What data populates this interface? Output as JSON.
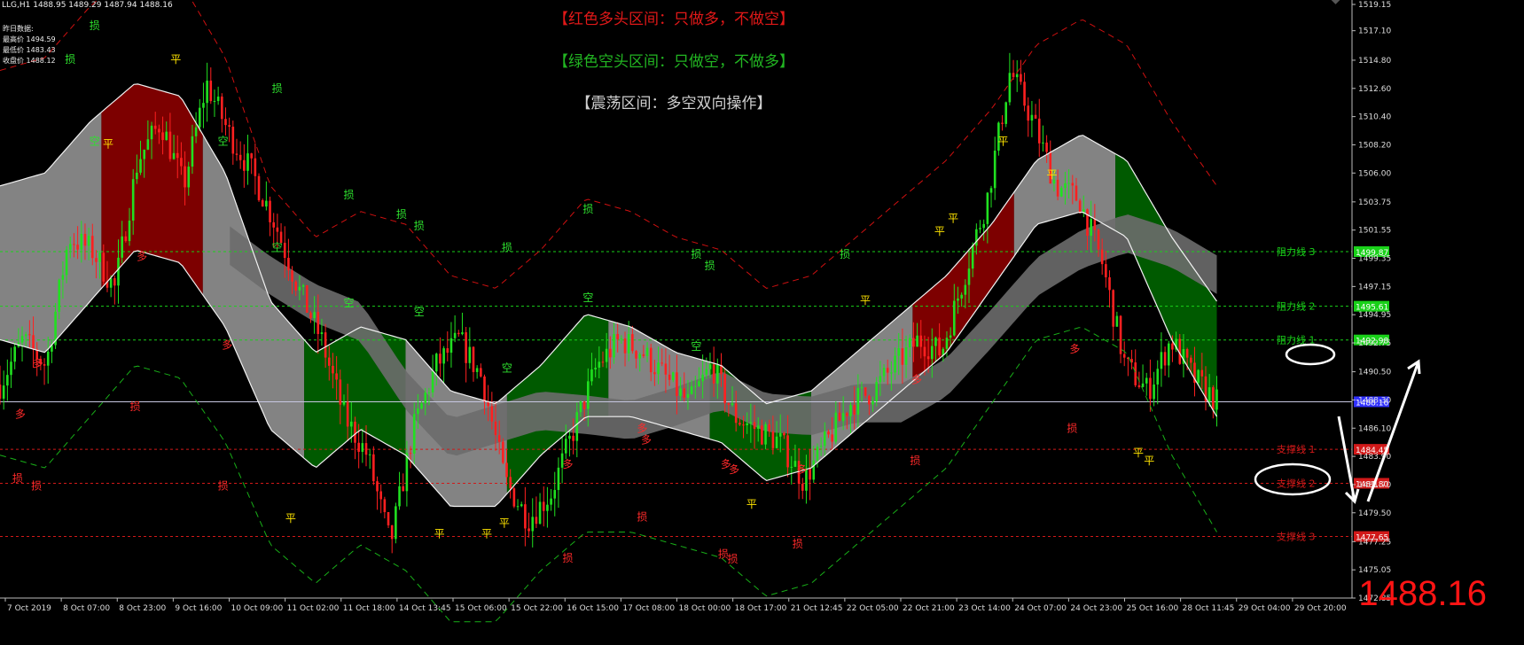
{
  "header": {
    "symbol_line": "LLG,H1  1488.95 1489.29 1487.94 1488.16",
    "prev_day_title": "昨日数据:",
    "prev_high": "最高价 1494.59",
    "prev_low": "最低价 1483.43",
    "prev_close": "收盘价 1488.12"
  },
  "banners": {
    "red": "【红色多头区间：只做多，不做空】",
    "green": "【绿色空头区间：只做空，不做多】",
    "gray": "【震荡区间：多空双向操作】"
  },
  "current_price": "1488.16",
  "colors": {
    "bull_zone": "#8b0000",
    "bear_zone": "#006400",
    "range_zone": "#9a9a9a",
    "candle_up": "#20e020",
    "candle_down": "#ff2020",
    "resistance": "#19d119",
    "support": "#d11919",
    "current_line": "#3030ff",
    "marker_yellow": "#ffe400"
  },
  "chart_data": {
    "type": "line",
    "title": "LLG,H1",
    "ylim": [
      1472.85,
      1519.15
    ],
    "y_ticks": [
      "1519.15",
      "1517.10",
      "1514.80",
      "1512.60",
      "1510.40",
      "1508.20",
      "1506.00",
      "1503.75",
      "1501.55",
      "1499.35",
      "1497.15",
      "1494.95",
      "1492.75",
      "1490.50",
      "1488.30",
      "1486.10",
      "1483.90",
      "1481.70",
      "1479.50",
      "1477.25",
      "1475.05",
      "1472.85"
    ],
    "x_labels": [
      "7 Oct 2019",
      "8 Oct 07:00",
      "8 Oct 23:00",
      "9 Oct 16:00",
      "10 Oct 09:00",
      "11 Oct 02:00",
      "11 Oct 18:00",
      "14 Oct 13:45",
      "15 Oct 06:00",
      "15 Oct 22:00",
      "16 Oct 15:00",
      "17 Oct 08:00",
      "18 Oct 00:00",
      "18 Oct 17:00",
      "21 Oct 12:45",
      "22 Oct 05:00",
      "22 Oct 21:00",
      "23 Oct 14:00",
      "24 Oct 07:00",
      "24 Oct 23:00",
      "25 Oct 16:00",
      "28 Oct 11:45",
      "29 Oct 04:00",
      "29 Oct 20:00"
    ],
    "series": [
      {
        "name": "price",
        "values": [
          1489.5,
          1493,
          1491,
          1501,
          1500,
          1497,
          1507,
          1510,
          1505,
          1513,
          1509,
          1506,
          1502,
          1497,
          1493,
          1487,
          1484,
          1477,
          1486,
          1491,
          1493,
          1490,
          1482,
          1479,
          1481,
          1486,
          1491,
          1493,
          1492,
          1490,
          1488,
          1491,
          1487,
          1486,
          1485,
          1482,
          1485,
          1488,
          1489,
          1491,
          1493,
          1492,
          1498,
          1504,
          1514,
          1510,
          1505,
          1504,
          1499,
          1491,
          1489,
          1493,
          1490,
          1488.16
        ]
      },
      {
        "name": "upper band",
        "values": [
          1505,
          1506,
          1510,
          1513,
          1512,
          1506,
          1496,
          1492,
          1494,
          1493,
          1489,
          1488,
          1491,
          1495,
          1494,
          1492,
          1491,
          1488,
          1489,
          1492,
          1495,
          1498,
          1502,
          1507,
          1509,
          1507,
          1501,
          1496
        ]
      },
      {
        "name": "lower band",
        "values": [
          1493,
          1492,
          1496,
          1500,
          1499,
          1494,
          1486,
          1483,
          1486,
          1484,
          1480,
          1480,
          1484,
          1487,
          1487,
          1486,
          1485,
          1482,
          1483,
          1486,
          1489,
          1492,
          1497,
          1502,
          1503,
          1501,
          1493,
          1487
        ]
      }
    ],
    "zones": [
      "range",
      "bull",
      "range",
      "bear",
      "range",
      "bear",
      "range",
      "bear",
      "range",
      "bull",
      "range",
      "bear"
    ],
    "levels": [
      {
        "label": "阻力线 3",
        "value": "1499.87",
        "kind": "resistance"
      },
      {
        "label": "阻力线 2",
        "value": "1495.61",
        "kind": "resistance"
      },
      {
        "label": "阻力线 1",
        "value": "1492.98",
        "kind": "resistance"
      },
      {
        "label": "支撑线 1",
        "value": "1484.45",
        "kind": "support"
      },
      {
        "label": "支撑线 2",
        "value": "1481.80",
        "kind": "support"
      },
      {
        "label": "支撑线 3",
        "value": "1477.65",
        "kind": "support"
      },
      {
        "label": "",
        "value": "1488.16",
        "kind": "current"
      }
    ],
    "annotations": [
      {
        "text": "平",
        "x": 0.13,
        "y": 1514.6
      },
      {
        "text": "平",
        "x": 0.08,
        "y": 1508.0
      },
      {
        "text": "平",
        "x": 0.215,
        "y": 1478.8
      },
      {
        "text": "平",
        "x": 0.325,
        "y": 1477.6
      },
      {
        "text": "平",
        "x": 0.36,
        "y": 1477.6
      },
      {
        "text": "平",
        "x": 0.373,
        "y": 1478.4
      },
      {
        "text": "平",
        "x": 0.556,
        "y": 1479.9
      },
      {
        "text": "平",
        "x": 0.64,
        "y": 1495.8
      },
      {
        "text": "平",
        "x": 0.695,
        "y": 1501.2
      },
      {
        "text": "平",
        "x": 0.705,
        "y": 1502.2
      },
      {
        "text": "平",
        "x": 0.742,
        "y": 1508.2
      },
      {
        "text": "平",
        "x": 0.778,
        "y": 1505.6
      },
      {
        "text": "平",
        "x": 0.842,
        "y": 1483.9
      },
      {
        "text": "平",
        "x": 0.85,
        "y": 1483.3
      },
      {
        "text": "空",
        "x": 0.07,
        "y": 1508.2
      },
      {
        "text": "空",
        "x": 0.165,
        "y": 1508.2
      },
      {
        "text": "空",
        "x": 0.205,
        "y": 1499.9
      },
      {
        "text": "空",
        "x": 0.258,
        "y": 1495.6
      },
      {
        "text": "空",
        "x": 0.31,
        "y": 1494.9
      },
      {
        "text": "空",
        "x": 0.375,
        "y": 1490.5
      },
      {
        "text": "空",
        "x": 0.435,
        "y": 1496.0
      },
      {
        "text": "空",
        "x": 0.515,
        "y": 1492.2
      },
      {
        "text": "多",
        "x": 0.015,
        "y": 1486.9
      },
      {
        "text": "多",
        "x": 0.028,
        "y": 1490.9
      },
      {
        "text": "多",
        "x": 0.105,
        "y": 1499.2
      },
      {
        "text": "多",
        "x": 0.168,
        "y": 1492.3
      },
      {
        "text": "多",
        "x": 0.42,
        "y": 1483.0
      },
      {
        "text": "多",
        "x": 0.475,
        "y": 1485.8
      },
      {
        "text": "多",
        "x": 0.478,
        "y": 1484.9
      },
      {
        "text": "多",
        "x": 0.537,
        "y": 1483.0
      },
      {
        "text": "多",
        "x": 0.543,
        "y": 1482.6
      },
      {
        "text": "多",
        "x": 0.593,
        "y": 1482.6
      },
      {
        "text": "多",
        "x": 0.678,
        "y": 1489.6
      },
      {
        "text": "多",
        "x": 0.795,
        "y": 1492.0
      },
      {
        "text": "损",
        "x": 0.07,
        "y": 1517.2
      },
      {
        "text": "损",
        "x": 0.052,
        "y": 1514.6
      },
      {
        "text": "损",
        "x": 0.205,
        "y": 1512.3
      },
      {
        "text": "损",
        "x": 0.258,
        "y": 1504.0
      },
      {
        "text": "损",
        "x": 0.297,
        "y": 1502.5
      },
      {
        "text": "损",
        "x": 0.31,
        "y": 1501.6
      },
      {
        "text": "损",
        "x": 0.375,
        "y": 1499.9
      },
      {
        "text": "损",
        "x": 0.435,
        "y": 1502.9
      },
      {
        "text": "损",
        "x": 0.515,
        "y": 1499.4
      },
      {
        "text": "损",
        "x": 0.525,
        "y": 1498.5
      },
      {
        "text": "损",
        "x": 0.625,
        "y": 1499.4
      },
      {
        "text": "损",
        "x": 0.013,
        "y": 1481.9
      },
      {
        "text": "损",
        "x": 0.027,
        "y": 1481.3
      },
      {
        "text": "损",
        "x": 0.1,
        "y": 1487.5
      },
      {
        "text": "损",
        "x": 0.165,
        "y": 1481.3
      },
      {
        "text": "损",
        "x": 0.42,
        "y": 1475.7
      },
      {
        "text": "损",
        "x": 0.475,
        "y": 1478.9
      },
      {
        "text": "损",
        "x": 0.535,
        "y": 1476.0
      },
      {
        "text": "损",
        "x": 0.542,
        "y": 1475.6
      },
      {
        "text": "损",
        "x": 0.59,
        "y": 1476.8
      },
      {
        "text": "损",
        "x": 0.677,
        "y": 1483.3
      },
      {
        "text": "损",
        "x": 0.793,
        "y": 1485.8
      }
    ]
  }
}
